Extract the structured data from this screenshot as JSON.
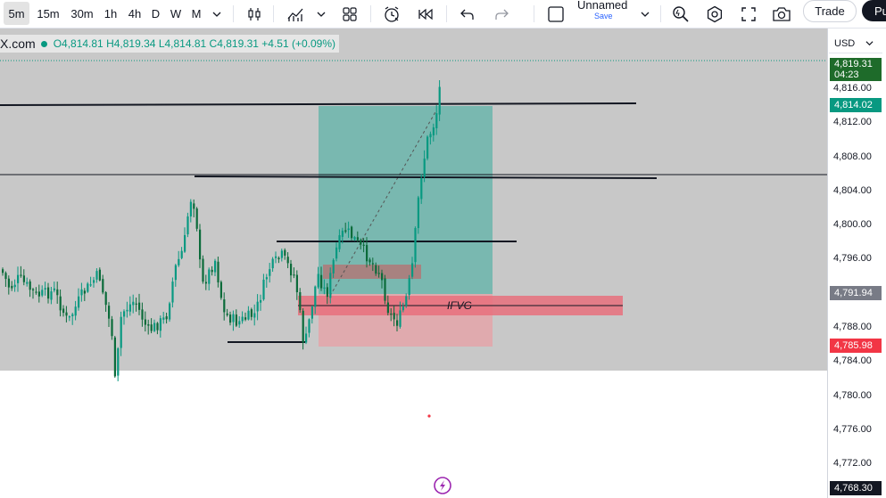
{
  "toolbar": {
    "timeframes": [
      "5m",
      "15m",
      "30m",
      "1h",
      "4h",
      "D",
      "W",
      "M"
    ],
    "active_timeframe": "5m",
    "layout_name": "Unnamed",
    "save_label": "Save",
    "trade_label": "Trade",
    "publish_label": "Pu"
  },
  "legend": {
    "symbol": "X.com",
    "open": "O4,814.81",
    "high": "H4,819.34",
    "low": "L4,814.81",
    "close": "C4,819.31",
    "change": "+4.51 (+0.09%)"
  },
  "annotation": {
    "ifvg_label": "IFVG"
  },
  "price_axis": {
    "currency": "USD",
    "ticks": [
      "4,816.00",
      "4,812.00",
      "4,808.00",
      "4,804.00",
      "4,800.00",
      "4,796.00",
      "4,788.00",
      "4,784.00",
      "4,780.00",
      "4,776.00",
      "4,772.00"
    ],
    "tick_values": [
      4816,
      4812,
      4808,
      4804,
      4800,
      4796,
      4788,
      4784,
      4780,
      4776,
      4772
    ],
    "current_price": "4,819.31",
    "countdown": "04:23",
    "target_price": "4,814.02",
    "entry_price": "4,791.94",
    "stop_price": "4,785.98",
    "bottom_price": "4,768.30"
  },
  "colors": {
    "up": "#089981",
    "down": "#0b6b3a",
    "profit_zone": "#5fb3a8",
    "loss_zone": "#e8a0a6",
    "fvg_zone": "#e8707c",
    "session_bg": "#c8c8c8"
  }
}
